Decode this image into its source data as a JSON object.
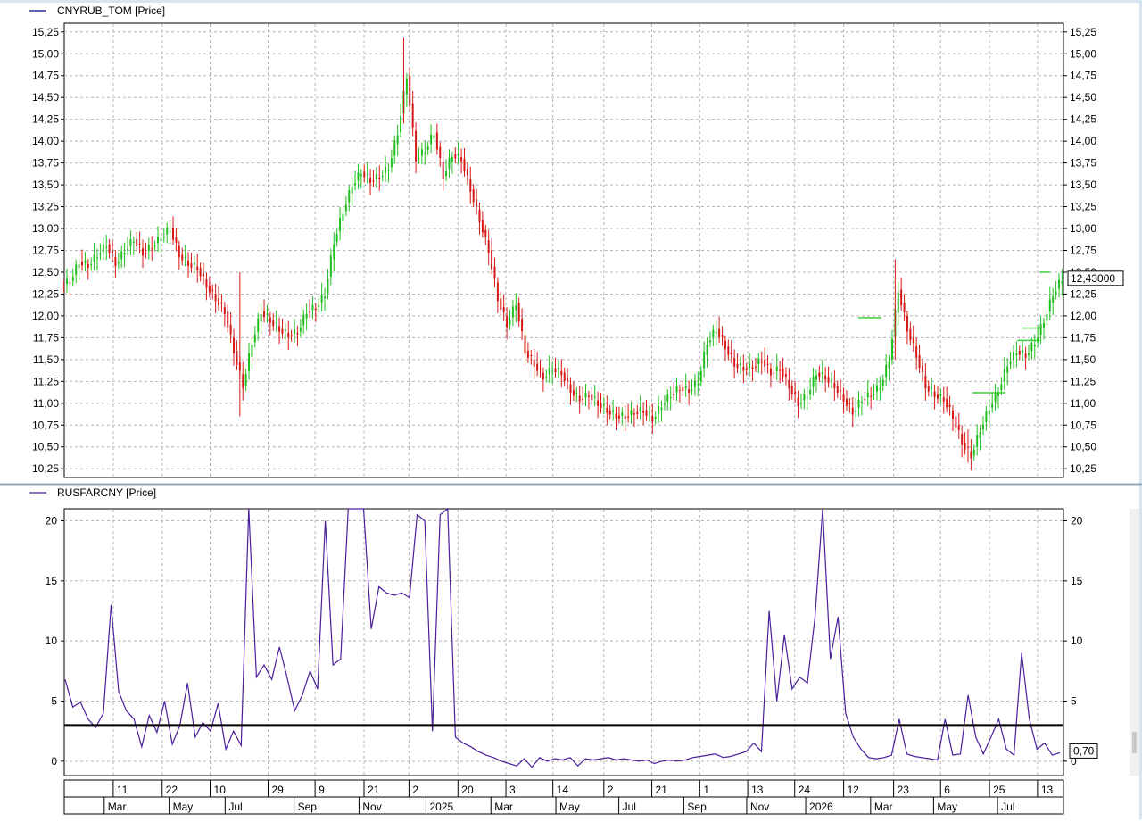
{
  "colors": {
    "up": "#1fbf1f",
    "down": "#d81818",
    "rusfar": "#4b1e9c",
    "hline": "#000000",
    "level": "#3bd13b",
    "grid": "#b4b4b4"
  },
  "chart_data": [
    {
      "type": "candlestick",
      "legend": "CNYRUB_TOM [Price]",
      "ylim": [
        10.15,
        15.35
      ],
      "yticks": [
        "15,25",
        "15,00",
        "14,75",
        "14,50",
        "14,25",
        "14,00",
        "13,75",
        "13,50",
        "13,25",
        "13,00",
        "12,75",
        "12,50",
        "12,25",
        "12,00",
        "11,75",
        "11,50",
        "11,25",
        "11,00",
        "10,75",
        "10,50",
        "10,25"
      ],
      "ytick_values": [
        15.25,
        15.0,
        14.75,
        14.5,
        14.25,
        14.0,
        13.75,
        13.5,
        13.25,
        13.0,
        12.75,
        12.5,
        12.25,
        12.0,
        11.75,
        11.5,
        11.25,
        11.0,
        10.75,
        10.5,
        10.25
      ],
      "last_price_label": "12,43000",
      "last_price": 12.43,
      "grid": true,
      "closes": [
        12.4,
        12.62,
        12.58,
        12.7,
        12.82,
        12.6,
        12.75,
        12.88,
        12.72,
        12.8,
        12.9,
        13.0,
        12.7,
        12.6,
        12.55,
        12.35,
        12.2,
        12.05,
        11.6,
        11.2,
        11.7,
        12.05,
        11.95,
        11.85,
        11.78,
        11.82,
        12.05,
        12.1,
        12.25,
        12.85,
        13.2,
        13.5,
        13.65,
        13.55,
        13.6,
        13.7,
        14.1,
        14.75,
        13.8,
        13.9,
        14.1,
        13.6,
        13.85,
        13.8,
        13.45,
        13.1,
        12.75,
        12.2,
        11.9,
        12.15,
        11.6,
        11.45,
        11.3,
        11.4,
        11.35,
        11.15,
        11.05,
        11.1,
        11.0,
        10.92,
        10.86,
        10.85,
        10.9,
        10.92,
        10.82,
        10.98,
        11.1,
        11.18,
        11.15,
        11.25,
        11.7,
        11.85,
        11.65,
        11.45,
        11.4,
        11.42,
        11.5,
        11.35,
        11.4,
        11.2,
        11.0,
        11.1,
        11.35,
        11.3,
        11.2,
        11.05,
        10.9,
        11.05,
        11.1,
        11.2,
        11.5,
        12.3,
        11.85,
        11.55,
        11.2,
        11.1,
        11.05,
        10.85,
        10.55,
        10.4,
        10.7,
        10.95,
        11.15,
        11.45,
        11.6,
        11.55,
        11.7,
        11.95,
        12.25,
        12.43
      ],
      "levels": [
        {
          "x": 0.883,
          "w": 0.023,
          "y": 11.98
        },
        {
          "x": 1.01,
          "w": 0.033,
          "y": 11.12
        },
        {
          "x": 1.06,
          "w": 0.022,
          "y": 11.72
        },
        {
          "x": 1.065,
          "w": 0.02,
          "y": 11.86
        },
        {
          "x": 1.085,
          "w": 0.01,
          "y": 12.5
        }
      ]
    },
    {
      "type": "line",
      "legend": "RUSFARCNY [Price]",
      "ylim": [
        -1.2,
        21.0
      ],
      "yticks": [
        "20",
        "15",
        "10",
        "5",
        "0"
      ],
      "ytick_values": [
        20,
        15,
        10,
        5,
        0
      ],
      "hline": 3.0,
      "last_value_label": "0,70",
      "last_value": 0.7,
      "grid": true,
      "values": [
        6.8,
        4.5,
        4.9,
        3.5,
        2.8,
        4.0,
        13.0,
        5.8,
        4.2,
        3.5,
        1.2,
        3.8,
        2.4,
        5.0,
        1.4,
        3.0,
        6.5,
        2.0,
        3.2,
        2.5,
        4.8,
        1.0,
        2.5,
        1.3,
        21,
        7.0,
        8.0,
        6.8,
        9.5,
        7.0,
        4.2,
        5.5,
        7.5,
        6.0,
        20,
        8.0,
        8.5,
        21,
        21,
        21,
        11,
        14.5,
        14.0,
        13.8,
        14.0,
        13.6,
        20.5,
        20.0,
        2.5,
        20.5,
        21,
        2.0,
        1.5,
        1.2,
        0.8,
        0.5,
        0.3,
        0.0,
        -0.2,
        -0.4,
        0.2,
        -0.5,
        0.3,
        0.0,
        0.2,
        0.1,
        0.3,
        -0.4,
        0.2,
        0.1,
        0.2,
        0.3,
        0.1,
        0.2,
        0.1,
        0.0,
        0.1,
        -0.2,
        0.0,
        0.1,
        0.0,
        0.1,
        0.3,
        0.4,
        0.5,
        0.6,
        0.3,
        0.4,
        0.6,
        0.8,
        1.5,
        0.8,
        12.5,
        5.0,
        10.5,
        6.0,
        7.0,
        6.5,
        12.0,
        21,
        8.5,
        12.0,
        4.0,
        2.0,
        1.0,
        0.3,
        0.2,
        0.3,
        0.5,
        3.5,
        0.6,
        0.4,
        0.3,
        0.2,
        0.1,
        3.5,
        0.5,
        0.6,
        5.5,
        2.0,
        0.6,
        2.0,
        3.5,
        1.0,
        0.5,
        9.0,
        3.5,
        1.0,
        1.5,
        0.5,
        0.7
      ]
    }
  ],
  "xaxis": {
    "days": [
      {
        "label": "11",
        "x": 0.049
      },
      {
        "label": "22",
        "x": 0.098
      },
      {
        "label": "10",
        "x": 0.146
      },
      {
        "label": "29",
        "x": 0.204
      },
      {
        "label": "9",
        "x": 0.251
      },
      {
        "label": "21",
        "x": 0.3
      },
      {
        "label": "2",
        "x": 0.345
      },
      {
        "label": "20",
        "x": 0.394
      },
      {
        "label": "3",
        "x": 0.442
      },
      {
        "label": "14",
        "x": 0.489
      },
      {
        "label": "2",
        "x": 0.54
      },
      {
        "label": "21",
        "x": 0.588
      },
      {
        "label": "1",
        "x": 0.636
      },
      {
        "label": "13",
        "x": 0.684
      },
      {
        "label": "24",
        "x": 0.731
      },
      {
        "label": "12",
        "x": 0.78
      },
      {
        "label": "23",
        "x": 0.83
      },
      {
        "label": "6",
        "x": 0.877
      },
      {
        "label": "25",
        "x": 0.926
      },
      {
        "label": "13",
        "x": 0.974
      }
    ],
    "months": [
      {
        "label": "Mar",
        "x": 0.04
      },
      {
        "label": "May",
        "x": 0.105
      },
      {
        "label": "Jul",
        "x": 0.161
      },
      {
        "label": "Sep",
        "x": 0.23
      },
      {
        "label": "Nov",
        "x": 0.295
      },
      {
        "label": "2025",
        "x": 0.362
      },
      {
        "label": "Mar",
        "x": 0.427
      },
      {
        "label": "May",
        "x": 0.492
      },
      {
        "label": "Jul",
        "x": 0.555
      },
      {
        "label": "Sep",
        "x": 0.62
      },
      {
        "label": "Nov",
        "x": 0.683
      },
      {
        "label": "2026",
        "x": 0.742
      },
      {
        "label": "Mar",
        "x": 0.807
      },
      {
        "label": "May",
        "x": 0.87
      },
      {
        "label": "Jul",
        "x": 0.934
      }
    ]
  }
}
